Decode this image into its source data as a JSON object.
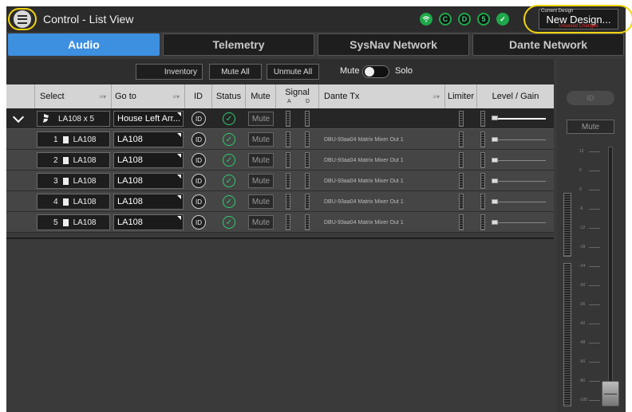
{
  "titlebar": {
    "title": "Control - List View",
    "menu_icon": "hamburger-menu-icon",
    "status": [
      {
        "icon": "wifi-icon",
        "label": ""
      },
      {
        "icon": "c-badge-icon",
        "label": "C"
      },
      {
        "icon": "d-badge-icon",
        "label": "D"
      },
      {
        "icon": "number-badge-icon",
        "label": "5"
      },
      {
        "icon": "check-badge-icon",
        "label": ""
      }
    ],
    "design": {
      "caption": "Current Design",
      "name": "New Design...",
      "unsaved": "Unsaved Changes"
    },
    "highlight_color": "#f2d40c"
  },
  "tabs": [
    {
      "label": "Audio",
      "active": true
    },
    {
      "label": "Telemetry",
      "active": false
    },
    {
      "label": "SysNav Network",
      "active": false
    },
    {
      "label": "Dante Network",
      "active": false
    }
  ],
  "toolbar": {
    "inventory": "Inventory",
    "mute_all": "Mute All",
    "unmute_all": "Unmute All",
    "mute_label": "Mute",
    "solo_label": "Solo"
  },
  "table": {
    "headers": {
      "select": "Select",
      "goto": "Go to",
      "id": "ID",
      "status": "Status",
      "mute": "Mute",
      "signal": "Signal",
      "signal_a": "A",
      "signal_d": "D",
      "dante_tx": "Dante Tx",
      "limiter": "Limiter",
      "level_gain": "Level / Gain"
    },
    "group": {
      "select": "LA108 x 5",
      "goto": "House Left Arr...",
      "id": "ID",
      "mute": "Mute"
    },
    "rows": [
      {
        "index": "1",
        "model": "LA108",
        "goto": "LA108",
        "id": "ID",
        "mute": "Mute",
        "dante": "DBU-93aa04 Matrix Mixer Out 1"
      },
      {
        "index": "2",
        "model": "LA108",
        "goto": "LA108",
        "id": "ID",
        "mute": "Mute",
        "dante": "DBU-93aa04 Matrix Mixer Out 1"
      },
      {
        "index": "3",
        "model": "LA108",
        "goto": "LA108",
        "id": "ID",
        "mute": "Mute",
        "dante": "DBU-93aa04 Matrix Mixer Out 1"
      },
      {
        "index": "4",
        "model": "LA108",
        "goto": "LA108",
        "id": "ID",
        "mute": "Mute",
        "dante": "DBU-93aa04 Matrix Mixer Out 1"
      },
      {
        "index": "5",
        "model": "LA108",
        "goto": "LA108",
        "id": "ID",
        "mute": "Mute",
        "dante": "DBU-93aa04 Matrix Mixer Out 1"
      }
    ]
  },
  "right_panel": {
    "id": "ID",
    "mute": "Mute",
    "scale": [
      "12",
      "6",
      "0",
      "-6",
      "-12",
      "-18",
      "-24",
      "-30",
      "-36",
      "-42",
      "-48",
      "-60",
      "-80",
      "-100"
    ]
  },
  "colors": {
    "accent": "#3d8fe0",
    "ok": "#2ecc71",
    "badge": "#1fa84a",
    "unsaved": "#ee3333"
  }
}
